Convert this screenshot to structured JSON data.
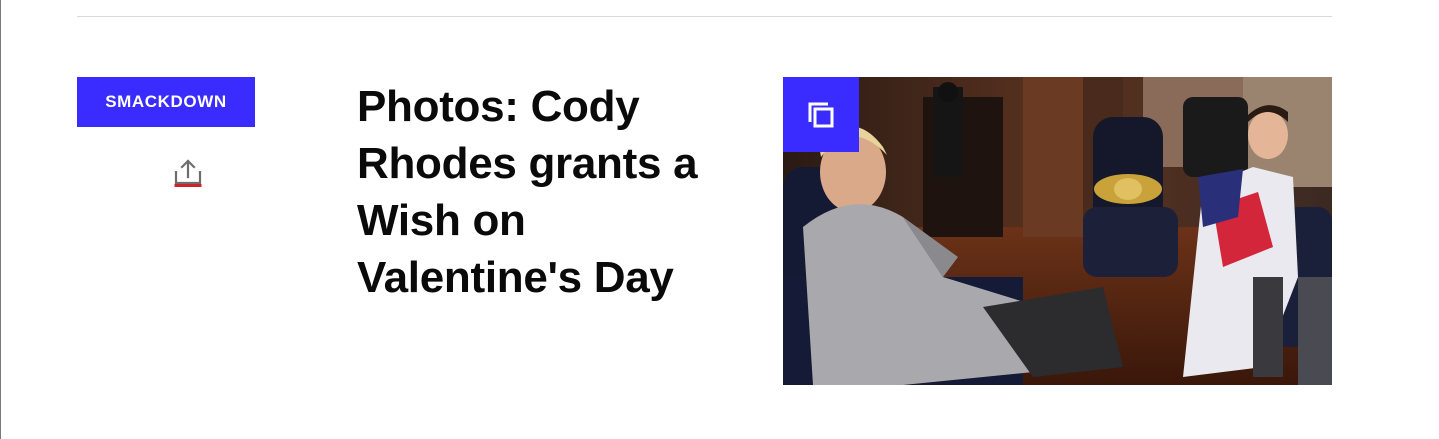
{
  "article": {
    "category": "SMACKDOWN",
    "headline": "Photos: Cody Rhodes grants a Wish on Valentine's Day"
  },
  "icons": {
    "share": "share-upload-icon",
    "gallery": "gallery-stack-icon"
  },
  "colors": {
    "accent": "#3a2cff",
    "share_underline": "#d0202a",
    "headline": "#0a0a0a",
    "divider": "#d9d9d9"
  }
}
